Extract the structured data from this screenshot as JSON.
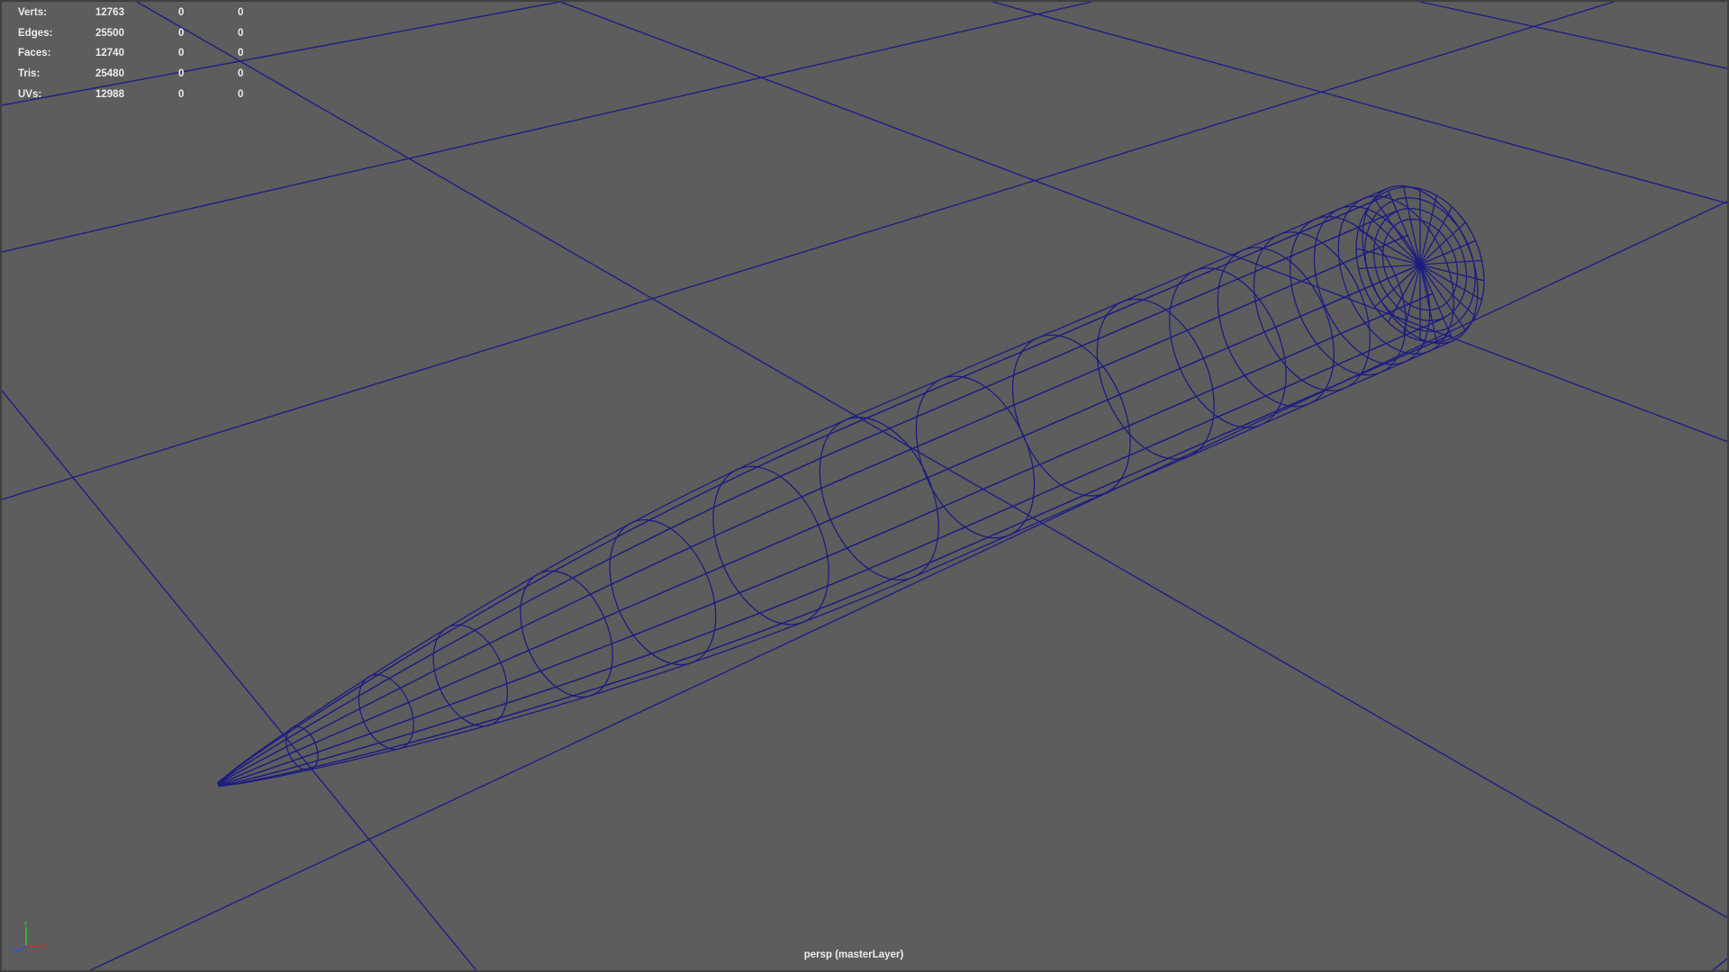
{
  "hud": {
    "rows": [
      {
        "label": "Verts:",
        "total": "12763",
        "selected": "0",
        "components": "0"
      },
      {
        "label": "Edges:",
        "total": "25500",
        "selected": "0",
        "components": "0"
      },
      {
        "label": "Faces:",
        "total": "12740",
        "selected": "0",
        "components": "0"
      },
      {
        "label": "Tris:",
        "total": "25480",
        "selected": "0",
        "components": "0"
      },
      {
        "label": "UVs:",
        "total": "12988",
        "selected": "0",
        "components": "0"
      }
    ]
  },
  "camera": {
    "label": "persp (masterLayer)"
  },
  "axis_gizmo": {
    "icon": "axis-gizmo-icon",
    "axes": [
      "Y",
      "Z",
      "X"
    ]
  },
  "colors": {
    "viewport_bg": "#5d5d5d",
    "wireframe": "#1c1c82",
    "grid": "#1f1f86",
    "hud_text": "#ececec",
    "axis_x": "#d03030",
    "axis_y": "#30c030",
    "axis_z": "#3050e0"
  }
}
